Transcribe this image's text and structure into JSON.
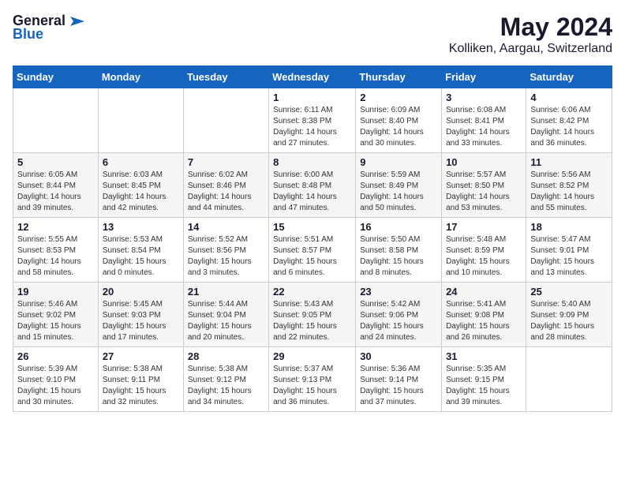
{
  "logo": {
    "general": "General",
    "blue": "Blue"
  },
  "title": {
    "month": "May 2024",
    "location": "Kolliken, Aargau, Switzerland"
  },
  "headers": [
    "Sunday",
    "Monday",
    "Tuesday",
    "Wednesday",
    "Thursday",
    "Friday",
    "Saturday"
  ],
  "weeks": [
    [
      {
        "day": "",
        "info": ""
      },
      {
        "day": "",
        "info": ""
      },
      {
        "day": "",
        "info": ""
      },
      {
        "day": "1",
        "info": "Sunrise: 6:11 AM\nSunset: 8:38 PM\nDaylight: 14 hours\nand 27 minutes."
      },
      {
        "day": "2",
        "info": "Sunrise: 6:09 AM\nSunset: 8:40 PM\nDaylight: 14 hours\nand 30 minutes."
      },
      {
        "day": "3",
        "info": "Sunrise: 6:08 AM\nSunset: 8:41 PM\nDaylight: 14 hours\nand 33 minutes."
      },
      {
        "day": "4",
        "info": "Sunrise: 6:06 AM\nSunset: 8:42 PM\nDaylight: 14 hours\nand 36 minutes."
      }
    ],
    [
      {
        "day": "5",
        "info": "Sunrise: 6:05 AM\nSunset: 8:44 PM\nDaylight: 14 hours\nand 39 minutes."
      },
      {
        "day": "6",
        "info": "Sunrise: 6:03 AM\nSunset: 8:45 PM\nDaylight: 14 hours\nand 42 minutes."
      },
      {
        "day": "7",
        "info": "Sunrise: 6:02 AM\nSunset: 8:46 PM\nDaylight: 14 hours\nand 44 minutes."
      },
      {
        "day": "8",
        "info": "Sunrise: 6:00 AM\nSunset: 8:48 PM\nDaylight: 14 hours\nand 47 minutes."
      },
      {
        "day": "9",
        "info": "Sunrise: 5:59 AM\nSunset: 8:49 PM\nDaylight: 14 hours\nand 50 minutes."
      },
      {
        "day": "10",
        "info": "Sunrise: 5:57 AM\nSunset: 8:50 PM\nDaylight: 14 hours\nand 53 minutes."
      },
      {
        "day": "11",
        "info": "Sunrise: 5:56 AM\nSunset: 8:52 PM\nDaylight: 14 hours\nand 55 minutes."
      }
    ],
    [
      {
        "day": "12",
        "info": "Sunrise: 5:55 AM\nSunset: 8:53 PM\nDaylight: 14 hours\nand 58 minutes."
      },
      {
        "day": "13",
        "info": "Sunrise: 5:53 AM\nSunset: 8:54 PM\nDaylight: 15 hours\nand 0 minutes."
      },
      {
        "day": "14",
        "info": "Sunrise: 5:52 AM\nSunset: 8:56 PM\nDaylight: 15 hours\nand 3 minutes."
      },
      {
        "day": "15",
        "info": "Sunrise: 5:51 AM\nSunset: 8:57 PM\nDaylight: 15 hours\nand 6 minutes."
      },
      {
        "day": "16",
        "info": "Sunrise: 5:50 AM\nSunset: 8:58 PM\nDaylight: 15 hours\nand 8 minutes."
      },
      {
        "day": "17",
        "info": "Sunrise: 5:48 AM\nSunset: 8:59 PM\nDaylight: 15 hours\nand 10 minutes."
      },
      {
        "day": "18",
        "info": "Sunrise: 5:47 AM\nSunset: 9:01 PM\nDaylight: 15 hours\nand 13 minutes."
      }
    ],
    [
      {
        "day": "19",
        "info": "Sunrise: 5:46 AM\nSunset: 9:02 PM\nDaylight: 15 hours\nand 15 minutes."
      },
      {
        "day": "20",
        "info": "Sunrise: 5:45 AM\nSunset: 9:03 PM\nDaylight: 15 hours\nand 17 minutes."
      },
      {
        "day": "21",
        "info": "Sunrise: 5:44 AM\nSunset: 9:04 PM\nDaylight: 15 hours\nand 20 minutes."
      },
      {
        "day": "22",
        "info": "Sunrise: 5:43 AM\nSunset: 9:05 PM\nDaylight: 15 hours\nand 22 minutes."
      },
      {
        "day": "23",
        "info": "Sunrise: 5:42 AM\nSunset: 9:06 PM\nDaylight: 15 hours\nand 24 minutes."
      },
      {
        "day": "24",
        "info": "Sunrise: 5:41 AM\nSunset: 9:08 PM\nDaylight: 15 hours\nand 26 minutes."
      },
      {
        "day": "25",
        "info": "Sunrise: 5:40 AM\nSunset: 9:09 PM\nDaylight: 15 hours\nand 28 minutes."
      }
    ],
    [
      {
        "day": "26",
        "info": "Sunrise: 5:39 AM\nSunset: 9:10 PM\nDaylight: 15 hours\nand 30 minutes."
      },
      {
        "day": "27",
        "info": "Sunrise: 5:38 AM\nSunset: 9:11 PM\nDaylight: 15 hours\nand 32 minutes."
      },
      {
        "day": "28",
        "info": "Sunrise: 5:38 AM\nSunset: 9:12 PM\nDaylight: 15 hours\nand 34 minutes."
      },
      {
        "day": "29",
        "info": "Sunrise: 5:37 AM\nSunset: 9:13 PM\nDaylight: 15 hours\nand 36 minutes."
      },
      {
        "day": "30",
        "info": "Sunrise: 5:36 AM\nSunset: 9:14 PM\nDaylight: 15 hours\nand 37 minutes."
      },
      {
        "day": "31",
        "info": "Sunrise: 5:35 AM\nSunset: 9:15 PM\nDaylight: 15 hours\nand 39 minutes."
      },
      {
        "day": "",
        "info": ""
      }
    ]
  ]
}
